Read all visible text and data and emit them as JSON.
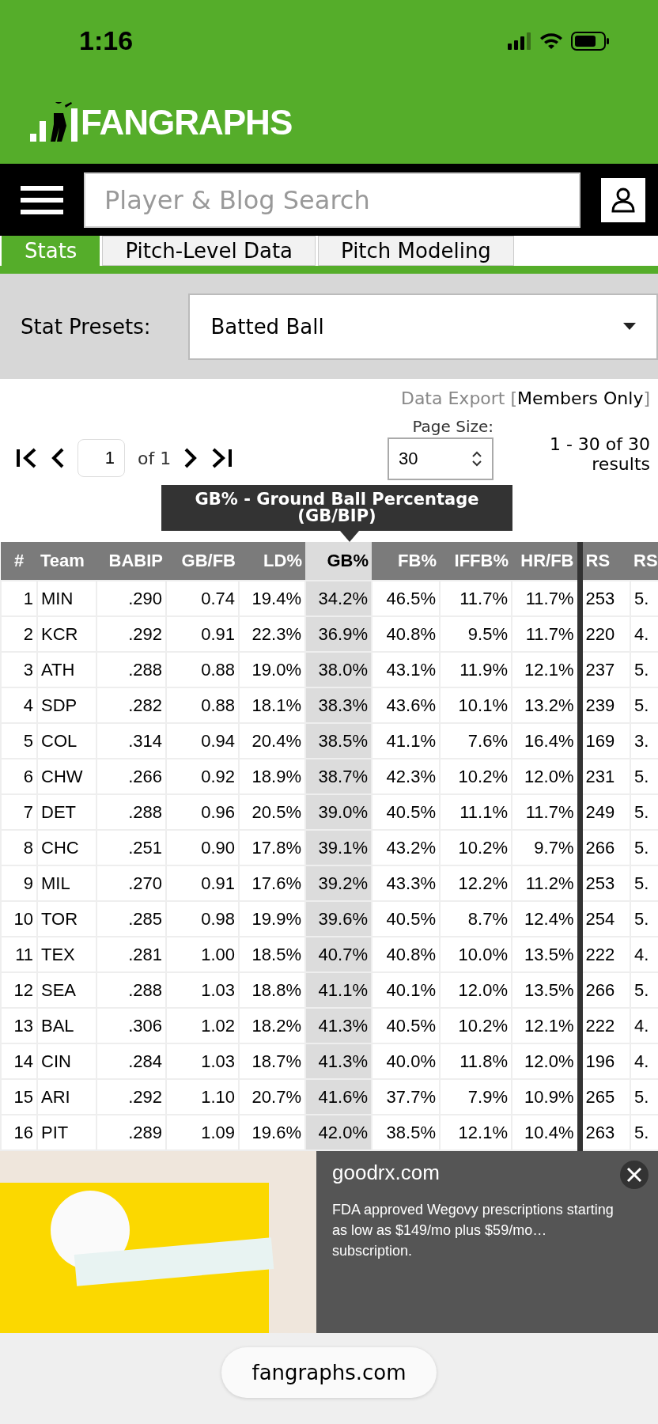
{
  "status_bar": {
    "time": "1:16"
  },
  "header": {
    "logo": "FANGRAPHS"
  },
  "nav": {
    "search": {
      "placeholder": "Player & Blog Search"
    }
  },
  "tabs": [
    {
      "label": "Stats",
      "selected": true
    },
    {
      "label": "Pitch-Level Data",
      "selected": false
    },
    {
      "label": "Pitch Modeling",
      "selected": false
    }
  ],
  "stat_presets": {
    "label": "Stat Presets:",
    "value": "Batted Ball"
  },
  "data_export": {
    "label": "Data Export",
    "bracket_open": "[",
    "link": "Members Only",
    "bracket_close": "]"
  },
  "pagination": {
    "page": "1",
    "of": "of 1",
    "page_size_label": "Page Size:",
    "page_size": "30",
    "results": "1 - 30 of 30 results"
  },
  "tooltip": {
    "text": "GB% - Ground Ball Percentage (GB/BIP)"
  },
  "table": {
    "columns": [
      {
        "label": "#",
        "selected": false
      },
      {
        "label": "Team",
        "selected": false
      },
      {
        "label": "BABIP",
        "selected": false
      },
      {
        "label": "GB/FB",
        "selected": false
      },
      {
        "label": "LD%",
        "selected": false
      },
      {
        "label": "GB%",
        "selected": true
      },
      {
        "label": "FB%",
        "selected": false
      },
      {
        "label": "IFFB%",
        "selected": false
      },
      {
        "label": "HR/FB",
        "selected": false
      },
      {
        "label": "RS",
        "selected": false
      },
      {
        "label": "RS",
        "selected": false
      }
    ],
    "rows": [
      [
        "1",
        "MIN",
        ".290",
        "0.74",
        "19.4%",
        "34.2%",
        "46.5%",
        "11.7%",
        "11.7%",
        "253",
        "5."
      ],
      [
        "2",
        "KCR",
        ".292",
        "0.91",
        "22.3%",
        "36.9%",
        "40.8%",
        "9.5%",
        "11.7%",
        "220",
        "4."
      ],
      [
        "3",
        "ATH",
        ".288",
        "0.88",
        "19.0%",
        "38.0%",
        "43.1%",
        "11.9%",
        "12.1%",
        "237",
        "5."
      ],
      [
        "4",
        "SDP",
        ".282",
        "0.88",
        "18.1%",
        "38.3%",
        "43.6%",
        "10.1%",
        "13.2%",
        "239",
        "5."
      ],
      [
        "5",
        "COL",
        ".314",
        "0.94",
        "20.4%",
        "38.5%",
        "41.1%",
        "7.6%",
        "16.4%",
        "169",
        "3."
      ],
      [
        "6",
        "CHW",
        ".266",
        "0.92",
        "18.9%",
        "38.7%",
        "42.3%",
        "10.2%",
        "12.0%",
        "231",
        "5."
      ],
      [
        "7",
        "DET",
        ".288",
        "0.96",
        "20.5%",
        "39.0%",
        "40.5%",
        "11.1%",
        "11.7%",
        "249",
        "5."
      ],
      [
        "8",
        "CHC",
        ".251",
        "0.90",
        "17.8%",
        "39.1%",
        "43.2%",
        "10.2%",
        "9.7%",
        "266",
        "5."
      ],
      [
        "9",
        "MIL",
        ".270",
        "0.91",
        "17.6%",
        "39.2%",
        "43.3%",
        "12.2%",
        "11.2%",
        "253",
        "5."
      ],
      [
        "10",
        "TOR",
        ".285",
        "0.98",
        "19.9%",
        "39.6%",
        "40.5%",
        "8.7%",
        "12.4%",
        "254",
        "5."
      ],
      [
        "11",
        "TEX",
        ".281",
        "1.00",
        "18.5%",
        "40.7%",
        "40.8%",
        "10.0%",
        "13.5%",
        "222",
        "4."
      ],
      [
        "12",
        "SEA",
        ".288",
        "1.03",
        "18.8%",
        "41.1%",
        "40.1%",
        "12.0%",
        "13.5%",
        "266",
        "5."
      ],
      [
        "13",
        "BAL",
        ".306",
        "1.02",
        "18.2%",
        "41.3%",
        "40.5%",
        "10.2%",
        "12.1%",
        "222",
        "4."
      ],
      [
        "14",
        "CIN",
        ".284",
        "1.03",
        "18.7%",
        "41.3%",
        "40.0%",
        "11.8%",
        "12.0%",
        "196",
        "4."
      ],
      [
        "15",
        "ARI",
        ".292",
        "1.10",
        "20.7%",
        "41.6%",
        "37.7%",
        "7.9%",
        "10.9%",
        "265",
        "5."
      ],
      [
        "16",
        "PIT",
        ".289",
        "1.09",
        "19.6%",
        "42.0%",
        "38.5%",
        "12.1%",
        "10.4%",
        "263",
        "5."
      ]
    ]
  },
  "ad": {
    "domain": "goodrx.com",
    "text": "FDA approved Wegovy prescriptions starting as low as $149/mo plus $59/mo… subscription."
  },
  "url_bar": {
    "domain": "fangraphs.com"
  }
}
